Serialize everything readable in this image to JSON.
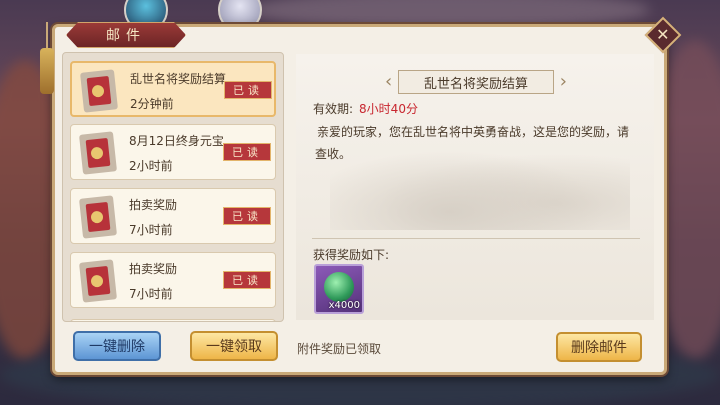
{
  "colors": {
    "panel_bg": "#f4efe6",
    "accent_red": "#b6373b",
    "expiry_red": "#c8262f",
    "button_gold": "#eeb548",
    "button_blue": "#5d95d4"
  },
  "panel": {
    "title": "邮件",
    "close_glyph": "✕"
  },
  "mail_list": [
    {
      "title": "乱世名将奖励结算",
      "time": "2分钟前",
      "status": "已读",
      "selected": true
    },
    {
      "title": "8月12日终身元宝...",
      "time": "2小时前",
      "status": "已读",
      "selected": false
    },
    {
      "title": "拍卖奖励",
      "time": "7小时前",
      "status": "已读",
      "selected": false
    },
    {
      "title": "拍卖奖励",
      "time": "7小时前",
      "status": "已读",
      "selected": false
    }
  ],
  "buttons": {
    "delete_all": "一键删除",
    "claim_all": "一键领取",
    "delete_mail": "删除邮件"
  },
  "detail": {
    "title": "乱世名将奖励结算",
    "expiry_label": "有效期:",
    "expiry_value": "8小时40分",
    "body": "亲爱的玩家，您在乱世名将中英勇奋战，这是您的奖励，请查收。",
    "reward_label": "获得奖励如下:",
    "reward_item": {
      "icon": "jade-dragon-icon",
      "quantity": "x4000"
    },
    "attachment_status": "附件奖励已领取"
  }
}
